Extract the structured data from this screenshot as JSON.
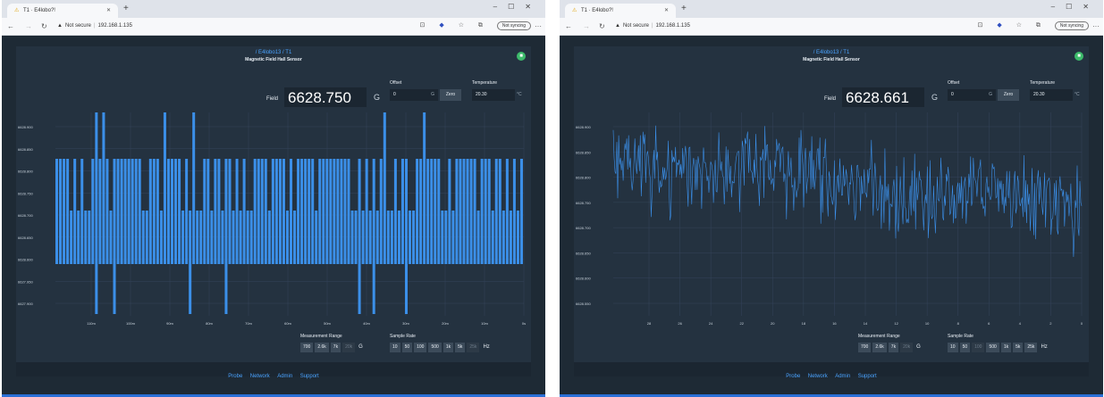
{
  "screenshots": [
    {
      "browser": {
        "tab_title": "T1 · E4lobo?!",
        "url_warning": "Not secure",
        "url": "192.168.1.135",
        "sync_label": "Not syncing"
      },
      "app": {
        "breadcrumb": "/ E4lobo13 / T1",
        "subtitle": "Magnetic Field Hall Sensor",
        "field_label": "Field",
        "field_value": "6628.750",
        "field_unit": "G",
        "offset_label": "Offset",
        "offset_value": "0",
        "offset_unit": "G",
        "zero_label": "Zero",
        "temperature_label": "Temperature",
        "temperature_value": "20.30",
        "temperature_unit": "°C",
        "measurement_range_label": "Measurement Range",
        "ranges": [
          "700",
          "2.6k",
          "7k",
          "20k"
        ],
        "range_unit": "G",
        "sample_rate_label": "Sample Rate",
        "rates": [
          "10",
          "50",
          "100",
          "500",
          "1k",
          "5k",
          "25k"
        ],
        "rate_unit": "Hz",
        "footer_links": [
          "Probe",
          "Network",
          "Admin",
          "Support"
        ]
      },
      "chart_data": {
        "type": "bar",
        "color": "#3b8fe8",
        "background": "#243240",
        "grid": true,
        "y_ticks": [
          "6628.900",
          "6628.850",
          "6628.800",
          "6628.750",
          "6628.700",
          "6628.650",
          "6628.600",
          "6627.950",
          "6627.900"
        ],
        "x_ticks": [
          "110m",
          "100m",
          "90m",
          "80m",
          "70m",
          "60m",
          "50m",
          "40m",
          "30m",
          "20m",
          "10m",
          "0s"
        ]
      }
    },
    {
      "browser": {
        "tab_title": "T1 · E4lobo?!",
        "url_warning": "Not secure",
        "url": "192.168.1.135",
        "sync_label": "Not syncing"
      },
      "app": {
        "breadcrumb": "/ E4lobo13 / T1",
        "subtitle": "Magnetic Field Hall Sensor",
        "field_label": "Field",
        "field_value": "6628.661",
        "field_unit": "G",
        "offset_label": "Offset",
        "offset_value": "0",
        "offset_unit": "G",
        "zero_label": "Zero",
        "temperature_label": "Temperature",
        "temperature_value": "20.30",
        "temperature_unit": "°C",
        "measurement_range_label": "Measurement Range",
        "ranges": [
          "700",
          "2.6k",
          "7k",
          "20k"
        ],
        "range_unit": "G",
        "sample_rate_label": "Sample Rate",
        "rates": [
          "10",
          "50",
          "100",
          "500",
          "1k",
          "5k",
          "25k"
        ],
        "rate_unit": "Hz",
        "footer_links": [
          "Probe",
          "Network",
          "Admin",
          "Support"
        ]
      },
      "chart_data": {
        "type": "line",
        "color": "#3b8fe8",
        "background": "#243240",
        "grid": true,
        "y_ticks": [
          "6628.900",
          "6628.850",
          "6628.800",
          "6628.750",
          "6628.700",
          "6628.650",
          "6628.600",
          "6628.550"
        ],
        "x_ticks": [
          "28",
          "26",
          "24",
          "22",
          "20",
          "18",
          "16",
          "14",
          "12",
          "10",
          "8",
          "6",
          "4",
          "2",
          "0"
        ]
      }
    }
  ]
}
